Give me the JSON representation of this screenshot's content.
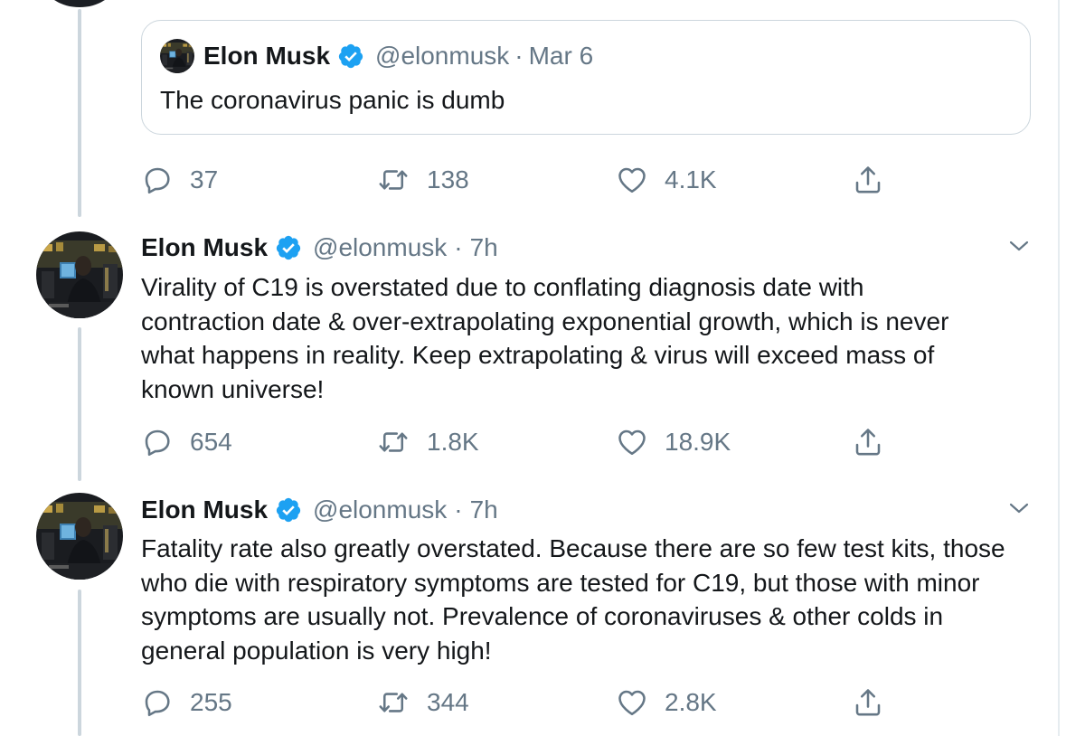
{
  "quoted_tweet": {
    "author_name": "Elon Musk",
    "handle": "@elonmusk",
    "separator": "·",
    "timestamp": "Mar 6",
    "text": "The coronavirus panic is dumb"
  },
  "first_actions": {
    "replies": "37",
    "retweets": "138",
    "likes": "4.1K"
  },
  "tweets": [
    {
      "author_name": "Elon Musk",
      "handle": "@elonmusk",
      "separator": "·",
      "timestamp": "7h",
      "lines": [
        "Virality of C19 is overstated due to conflating diagnosis date with",
        "contraction date & over-extrapolating exponential growth, which is never",
        "what happens in reality. Keep extrapolating & virus will exceed mass of",
        "known universe!"
      ],
      "replies": "654",
      "retweets": "1.8K",
      "likes": "18.9K"
    },
    {
      "author_name": "Elon Musk",
      "handle": "@elonmusk",
      "separator": "·",
      "timestamp": "7h",
      "lines": [
        "Fatality rate also greatly overstated. Because there are so few test kits, those",
        "who die with respiratory symptoms are tested for C19, but those with minor",
        "symptoms are usually not. Prevalence of coronaviruses & other colds in",
        "general population is very high!"
      ],
      "replies": "255",
      "retweets": "344",
      "likes": "2.8K"
    }
  ],
  "icons": {
    "reply": "reply-icon",
    "retweet": "retweet-icon",
    "like": "like-icon",
    "share": "share-icon",
    "verified": "verified-badge-icon",
    "caret": "chevron-down-icon"
  },
  "colors": {
    "verified_blue": "#1da1f2",
    "secondary_text": "#657786",
    "thread_line": "#ccd6dd"
  }
}
